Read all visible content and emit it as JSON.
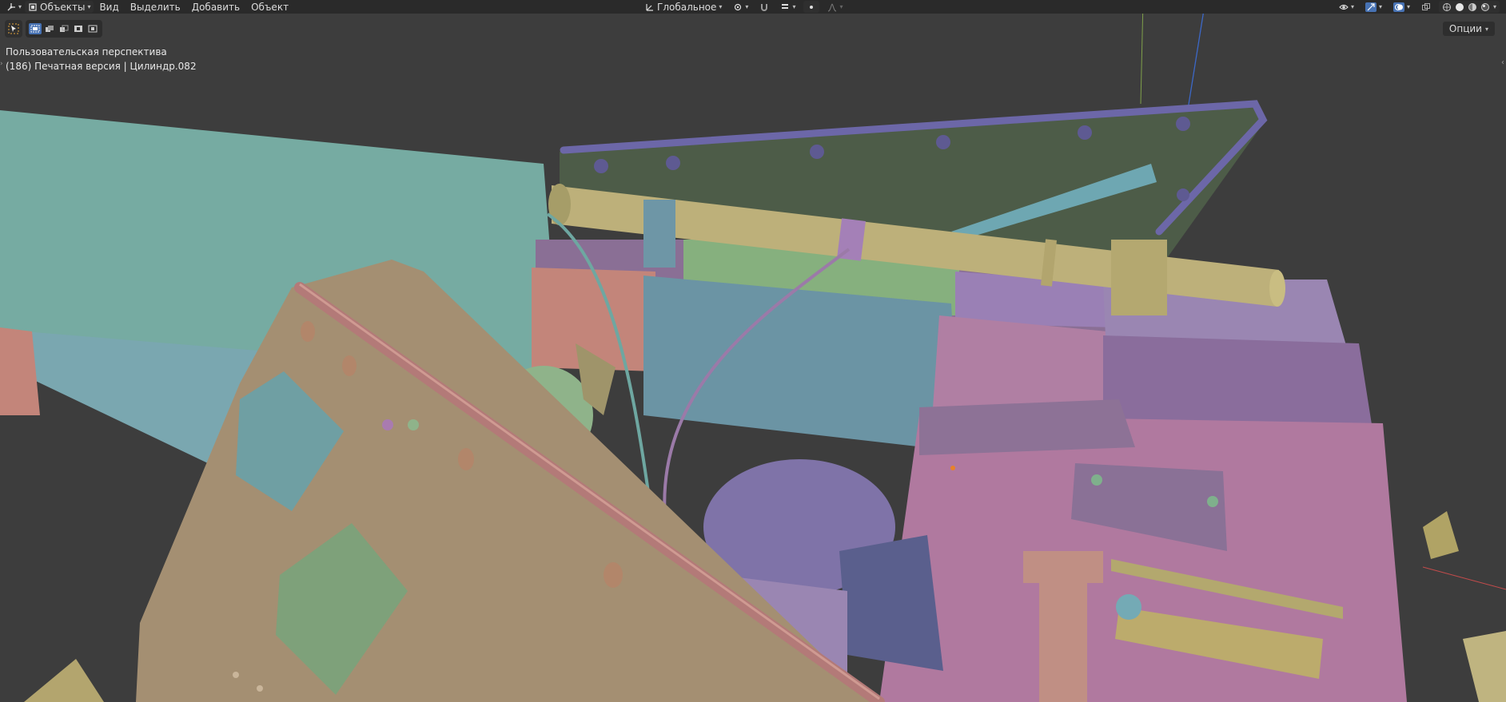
{
  "header": {
    "mode_label": "Объекты",
    "menu": [
      "Вид",
      "Выделить",
      "Добавить",
      "Объект"
    ],
    "transform_orientation": "Глобальное"
  },
  "viewport": {
    "view_name": "Пользовательская перспектива",
    "object_info": "(186) Печатная версия | Цилиндр.082",
    "options_label": "Опции"
  },
  "icons": {
    "editor_type": "viewport-icon",
    "mode": "object-mode-icon",
    "orientation": "transform-orientation-icon",
    "pivot": "pivot-point-icon",
    "snap": "magnet-icon",
    "proportional": "proportional-edit-icon",
    "visibility": "eye-icon",
    "gizmo": "gizmo-icon",
    "overlays": "overlays-icon",
    "xray": "xray-icon",
    "shading": [
      "wireframe-icon",
      "solid-icon",
      "material-preview-icon",
      "rendered-icon"
    ]
  },
  "colors": {
    "header_bg": "#2a2a2a",
    "viewport_bg": "#3d3d3d",
    "accent": "#4772b3"
  }
}
